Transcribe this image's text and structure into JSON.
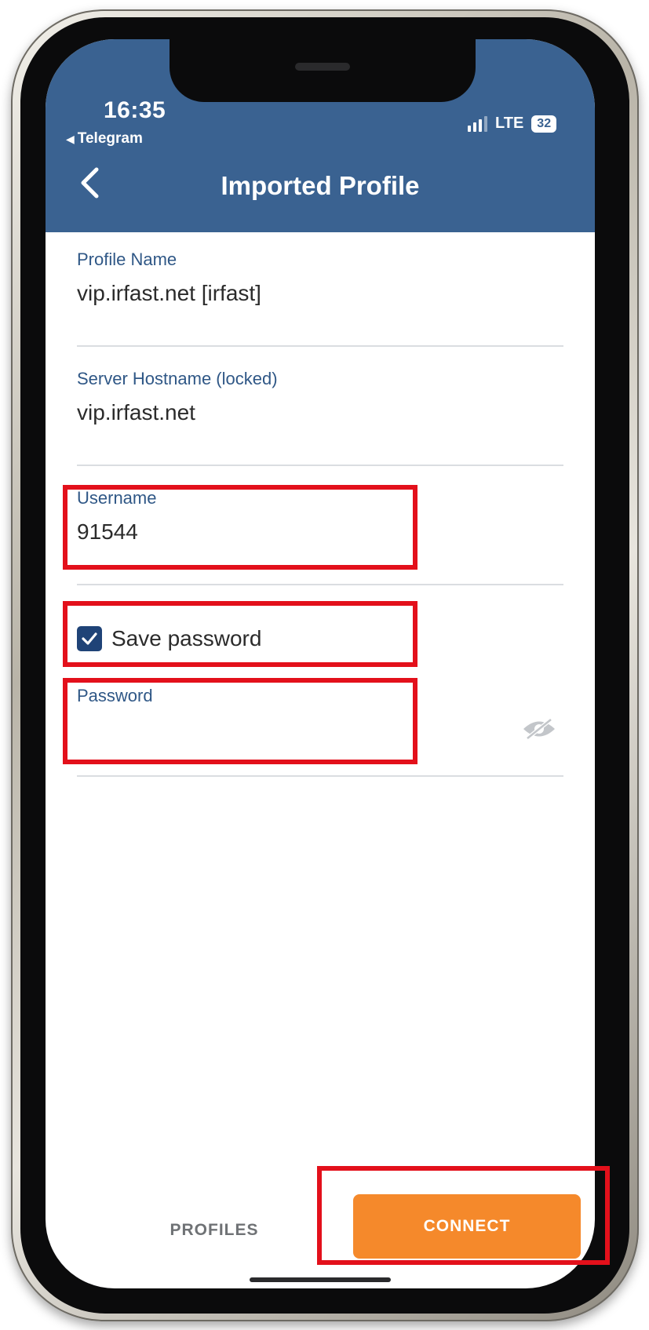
{
  "status_bar": {
    "time": "16:35",
    "back_app": "Telegram",
    "network": "LTE",
    "battery": "32"
  },
  "header": {
    "title": "Imported Profile",
    "color": "#3a6291"
  },
  "form": {
    "profile_name": {
      "label": "Profile Name",
      "value": "vip.irfast.net [irfast]"
    },
    "server_hostname": {
      "label": "Server Hostname (locked)",
      "value": "vip.irfast.net"
    },
    "username": {
      "label": "Username",
      "value": "91544"
    },
    "save_password": {
      "label": "Save password",
      "checked": true
    },
    "password": {
      "label": "Password",
      "value": ""
    }
  },
  "footer": {
    "profiles_label": "PROFILES",
    "connect_label": "CONNECT",
    "accent": "#f5892b"
  },
  "annotation_color": "#e3101b"
}
